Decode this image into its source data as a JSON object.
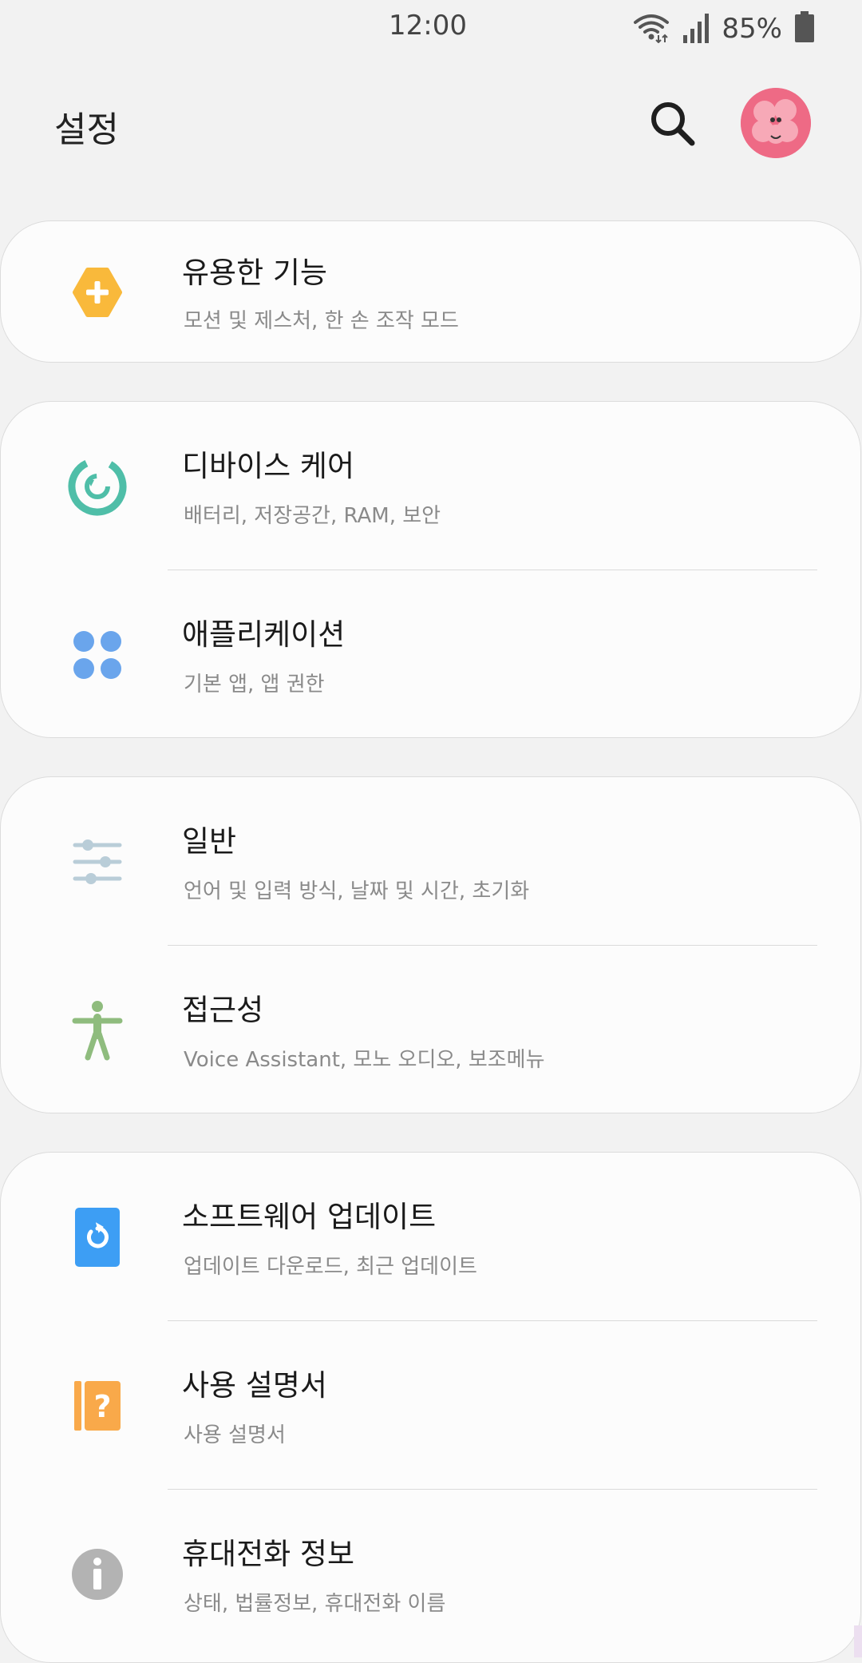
{
  "status_bar": {
    "time": "12:00",
    "battery_percent": "85%",
    "icons": [
      "wifi-icon",
      "signal-icon",
      "battery-icon"
    ]
  },
  "header": {
    "title": "설정",
    "search_icon": "search-icon",
    "avatar": "avatar"
  },
  "cards": [
    {
      "items": [
        {
          "title": "유용한 기능",
          "subtitle": "모션 및 제스처, 한 손 조작 모드",
          "icon": "advanced-features-icon",
          "color": "#f9b93b"
        }
      ]
    },
    {
      "items": [
        {
          "title": "디바이스 케어",
          "subtitle": "배터리, 저장공간, RAM, 보안",
          "icon": "device-care-icon",
          "color": "#4fbea8"
        },
        {
          "title": "애플리케이션",
          "subtitle": "기본 앱, 앱 권한",
          "icon": "apps-icon",
          "color": "#6aa5ec"
        }
      ]
    },
    {
      "items": [
        {
          "title": "일반",
          "subtitle": "언어 및 입력 방식, 날짜 및 시간, 초기화",
          "icon": "general-management-icon",
          "color": "#b9cdd8"
        },
        {
          "title": "접근성",
          "subtitle": "Voice Assistant, 모노 오디오, 보조메뉴",
          "icon": "accessibility-icon",
          "color": "#8fbc7e"
        }
      ]
    },
    {
      "items": [
        {
          "title": "소프트웨어 업데이트",
          "subtitle": "업데이트 다운로드, 최근 업데이트",
          "icon": "software-update-icon",
          "color": "#3d9ef4"
        },
        {
          "title": "사용 설명서",
          "subtitle": "사용 설명서",
          "icon": "user-manual-icon",
          "color": "#f9a94a"
        },
        {
          "title": "휴대전화 정보",
          "subtitle": "상태, 법률정보, 휴대전화 이름",
          "icon": "about-phone-icon",
          "color": "#b3b3b3"
        }
      ]
    }
  ]
}
